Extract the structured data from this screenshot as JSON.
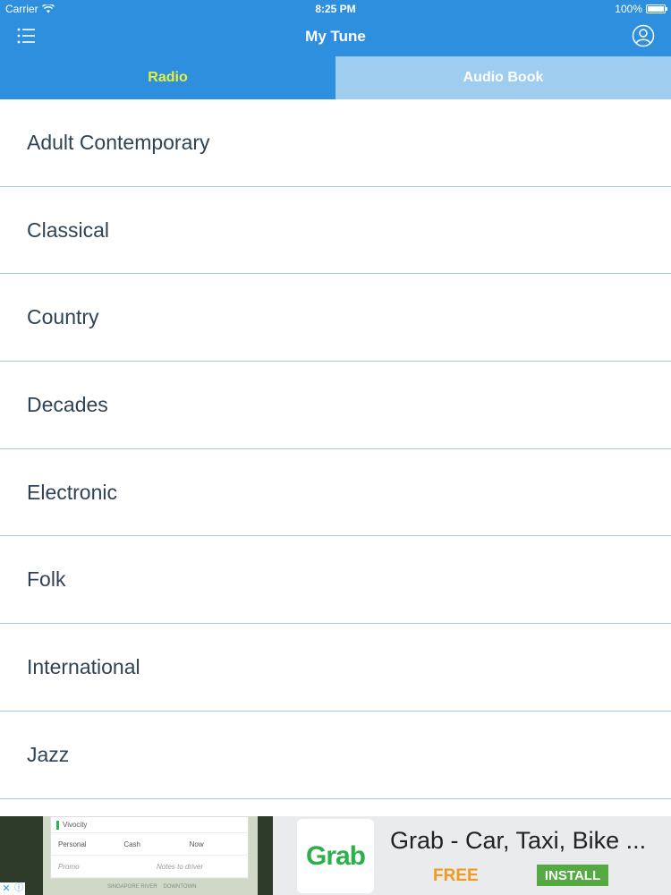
{
  "status_bar": {
    "carrier": "Carrier",
    "time": "8:25 PM",
    "battery": "100%",
    "battery_level": 1.0
  },
  "navbar": {
    "title": "My Tune",
    "menu_icon": "list-menu-icon",
    "profile_icon": "user-profile-icon"
  },
  "tabs": [
    {
      "label": "Radio",
      "active": true
    },
    {
      "label": "Audio Book",
      "active": false
    }
  ],
  "genres": [
    "Adult Contemporary",
    "Classical",
    "Country",
    "Decades",
    "Electronic",
    "Folk",
    "International",
    "Jazz"
  ],
  "ad": {
    "screenshot": {
      "location": "Vivocity",
      "options": [
        "Personal",
        "Cash",
        "Now"
      ],
      "extras": [
        "Promo",
        "Notes to driver"
      ],
      "map_labels": [
        "SINGAPORE RIVER",
        "DOWNTOWN"
      ]
    },
    "logo_text": "Grab",
    "title": "Grab - Car, Taxi, Bike ...",
    "price": "FREE",
    "install_label": "INSTALL",
    "close_glyph": "✕",
    "info_glyph": "ⓘ"
  },
  "colors": {
    "primary_blue": "#2d8fde",
    "tab_inactive": "#9fcdef",
    "tab_active_text": "#e6f23a",
    "list_text": "#2f4356",
    "separator": "#a7c9df",
    "ad_free": "#f39a1e",
    "ad_install": "#54a943",
    "grab_green": "#2cb04b"
  }
}
